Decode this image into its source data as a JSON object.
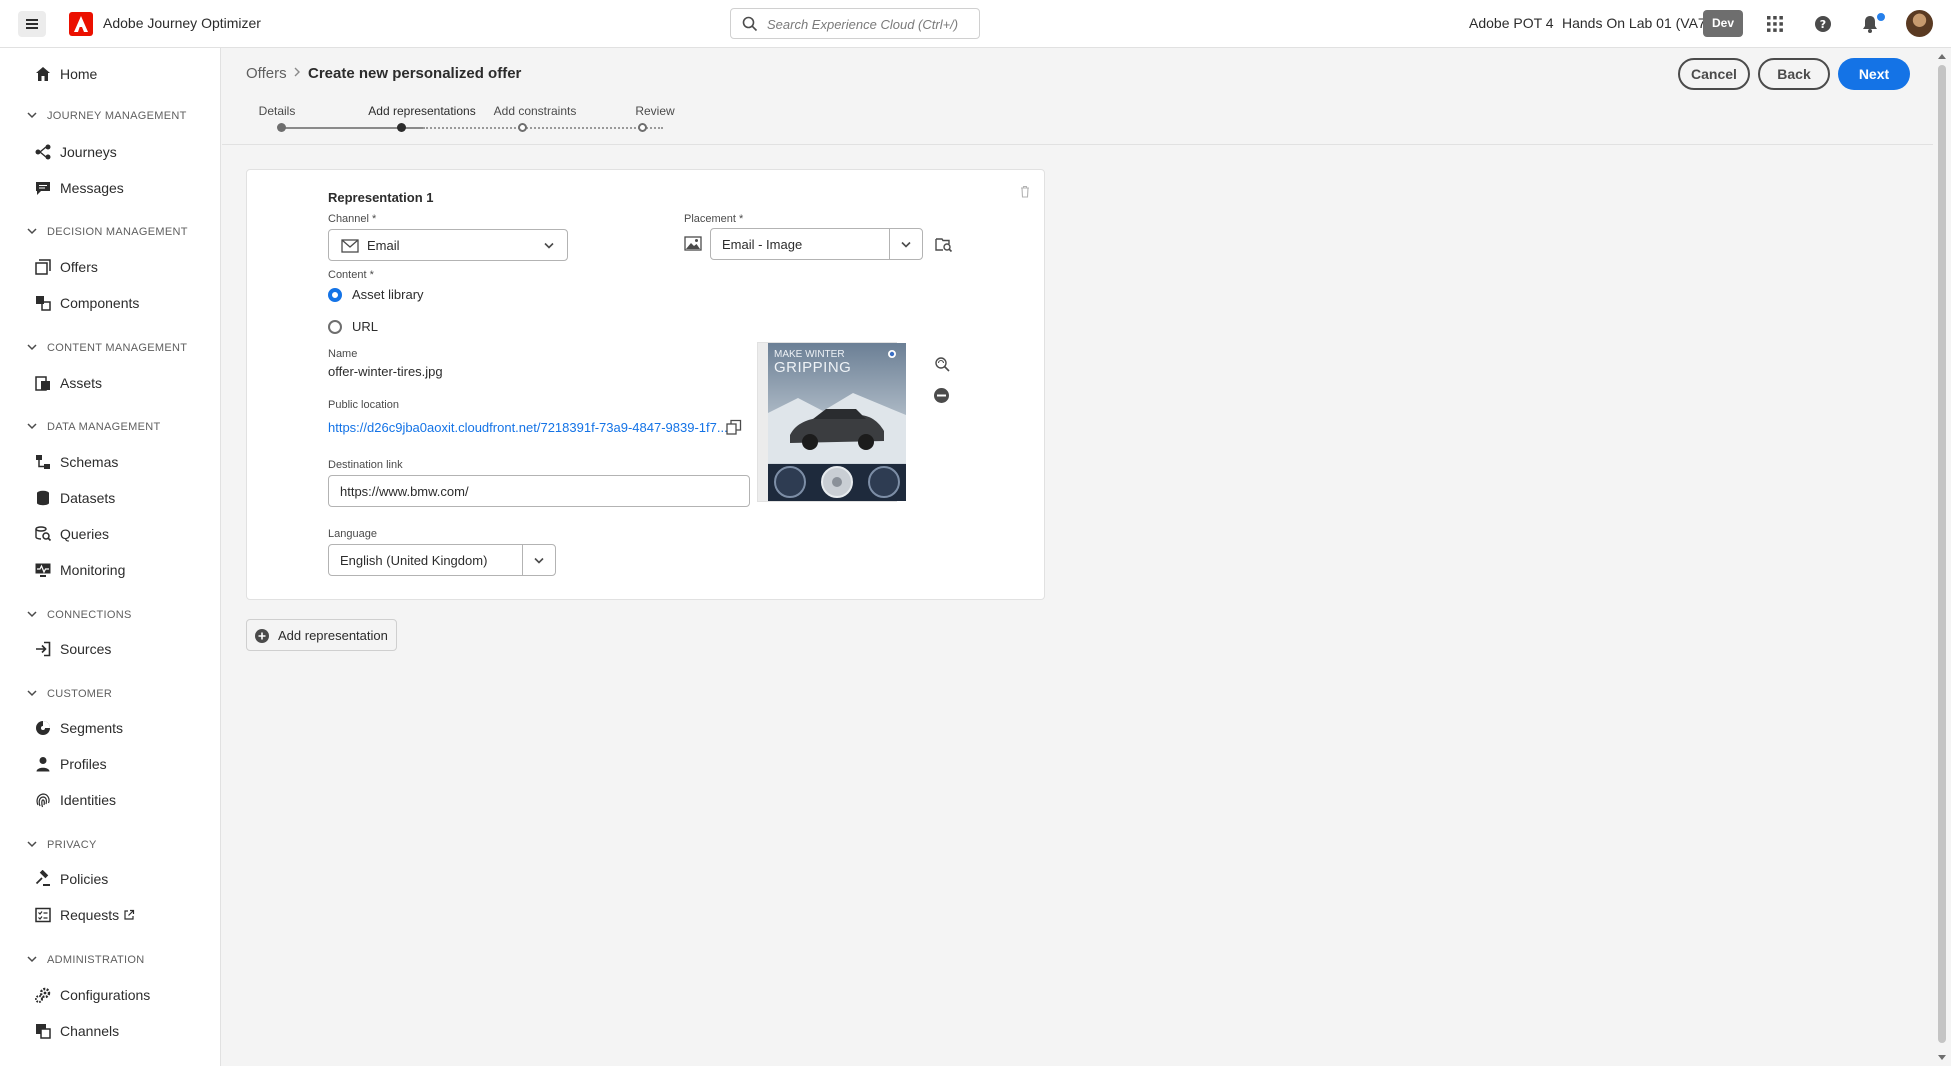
{
  "header": {
    "app_title": "Adobe Journey Optimizer",
    "search_placeholder": "Search Experience Cloud (Ctrl+/)",
    "org": "Adobe POT 4",
    "sandbox": "Hands On Lab 01 (VA7)",
    "environment_badge": "Dev",
    "icons": [
      "menu-icon",
      "adobe-logo",
      "search-icon",
      "apps-grid-icon",
      "help-icon",
      "bell-icon",
      "avatar"
    ],
    "accent_color": "#1473e6",
    "brand_color": "#eb1000"
  },
  "sidebar": {
    "home": "Home",
    "sections": [
      {
        "heading": "JOURNEY MANAGEMENT",
        "items": [
          "Journeys",
          "Messages"
        ]
      },
      {
        "heading": "DECISION MANAGEMENT",
        "items": [
          "Offers",
          "Components"
        ]
      },
      {
        "heading": "CONTENT MANAGEMENT",
        "items": [
          "Assets"
        ]
      },
      {
        "heading": "DATA MANAGEMENT",
        "items": [
          "Schemas",
          "Datasets",
          "Queries",
          "Monitoring"
        ]
      },
      {
        "heading": "CONNECTIONS",
        "items": [
          "Sources"
        ]
      },
      {
        "heading": "CUSTOMER",
        "items": [
          "Segments",
          "Profiles",
          "Identities"
        ]
      },
      {
        "heading": "PRIVACY",
        "items": [
          "Policies",
          "Requests"
        ]
      },
      {
        "heading": "ADMINISTRATION",
        "items": [
          "Configurations",
          "Channels"
        ]
      }
    ]
  },
  "page": {
    "breadcrumb_parent": "Offers",
    "title": "Create new personalized offer",
    "buttons": {
      "cancel": "Cancel",
      "back": "Back",
      "next": "Next"
    },
    "steps": [
      "Details",
      "Add representations",
      "Add constraints",
      "Review"
    ],
    "current_step": 2
  },
  "representation": {
    "title": "Representation 1",
    "channel_label": "Channel",
    "channel_value": "Email",
    "placement_label": "Placement",
    "placement_value": "Email - Image",
    "content_label": "Content",
    "content_options": [
      "Asset library",
      "URL"
    ],
    "content_selected": "Asset library",
    "name_label": "Name",
    "name_value": "offer-winter-tires.jpg",
    "public_location_label": "Public location",
    "public_location_value": "https://d26c9jba0aoxit.cloudfront.net/7218391f-73a9-4847-9839-1f7...",
    "destination_label": "Destination link",
    "destination_value": "https://www.bmw.com/",
    "language_label": "Language",
    "language_value": "English (United Kingdom)",
    "thumbnail_text_1": "MAKE WINTER",
    "thumbnail_text_2": "GRIPPING"
  },
  "add_representation": "Add representation"
}
